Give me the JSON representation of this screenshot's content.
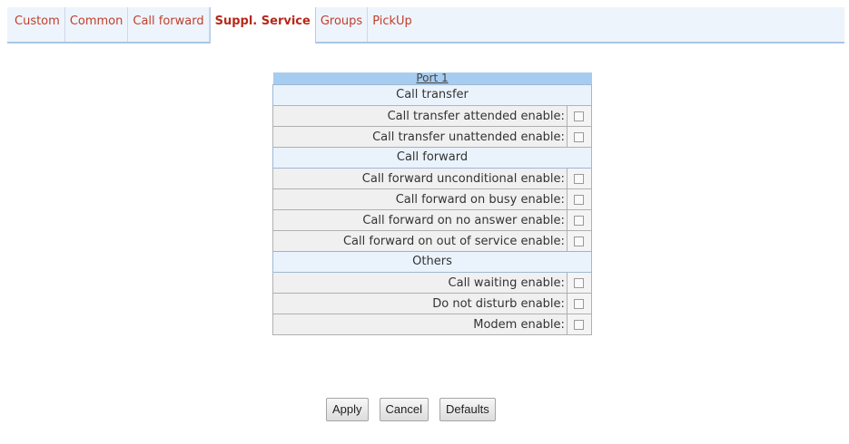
{
  "tabs": [
    {
      "label": "Custom",
      "active": false
    },
    {
      "label": "Common",
      "active": false
    },
    {
      "label": "Call forward",
      "active": false
    },
    {
      "label": "Suppl. Service",
      "active": true
    },
    {
      "label": "Groups",
      "active": false
    },
    {
      "label": "PickUp",
      "active": false
    }
  ],
  "panel": {
    "port_title": "Port 1",
    "sections": [
      {
        "title": "Call transfer",
        "rows": [
          {
            "label": "Call transfer attended enable:",
            "checked": false
          },
          {
            "label": "Call transfer unattended enable:",
            "checked": false
          }
        ]
      },
      {
        "title": "Call forward",
        "rows": [
          {
            "label": "Call forward unconditional enable:",
            "checked": false
          },
          {
            "label": "Call forward on busy enable:",
            "checked": false
          },
          {
            "label": "Call forward on no answer enable:",
            "checked": false
          },
          {
            "label": "Call forward on out of service enable:",
            "checked": false
          }
        ]
      },
      {
        "title": "Others",
        "rows": [
          {
            "label": "Call waiting enable:",
            "checked": false
          },
          {
            "label": "Do not disturb enable:",
            "checked": false
          },
          {
            "label": "Modem enable:",
            "checked": false
          }
        ]
      }
    ]
  },
  "buttons": {
    "apply": "Apply",
    "cancel": "Cancel",
    "defaults": "Defaults"
  }
}
